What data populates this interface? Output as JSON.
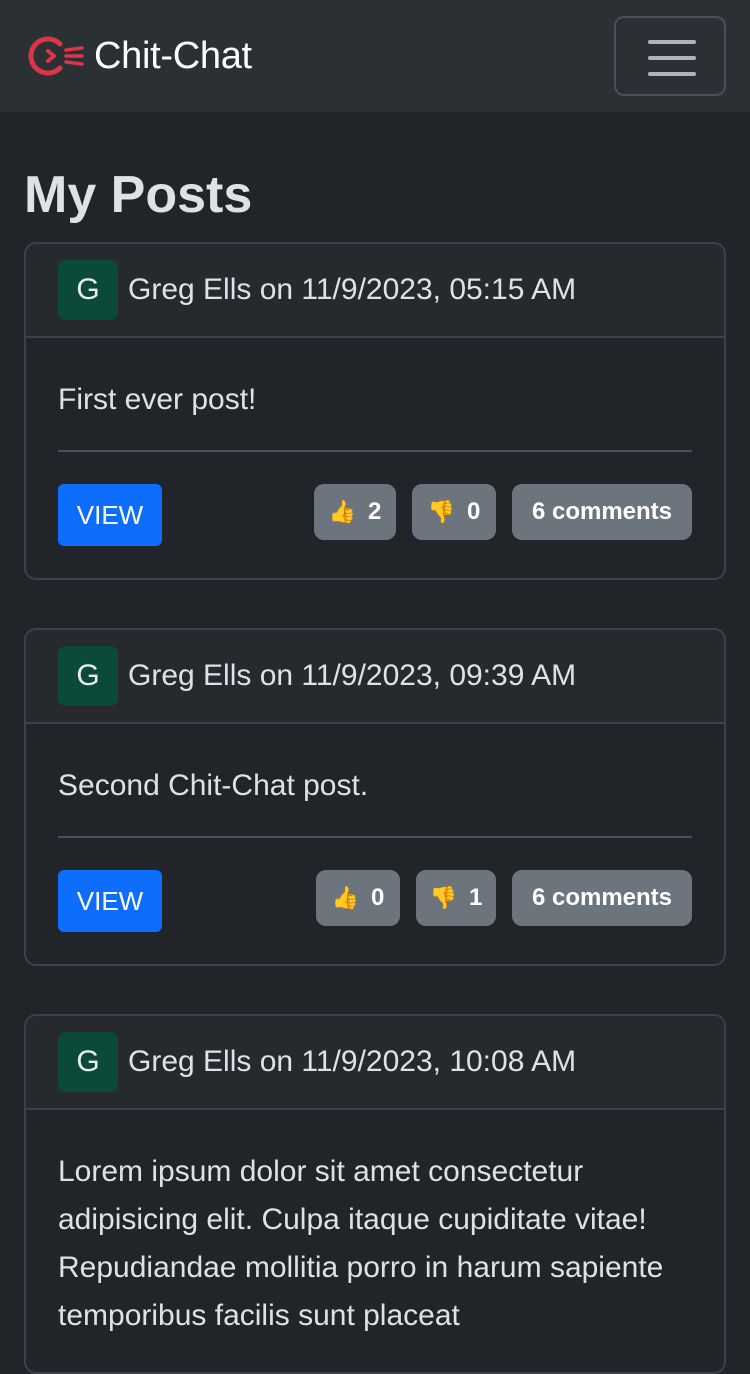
{
  "navbar": {
    "brand_name": "Chit-Chat",
    "logo_icon": "chat-mouth-icon",
    "logo_color": "#dc3545",
    "menu_icon": "hamburger-menu-icon"
  },
  "page": {
    "title": "My Posts"
  },
  "posts": [
    {
      "avatar_initial": "G",
      "author_line": "Greg Ells on 11/9/2023, 05:15 AM",
      "text": "First ever post!",
      "view_label": "VIEW",
      "likes": "2",
      "dislikes": "0",
      "comments_label": "6 comments"
    },
    {
      "avatar_initial": "G",
      "author_line": "Greg Ells on 11/9/2023, 09:39 AM",
      "text": "Second Chit-Chat post.",
      "view_label": "VIEW",
      "likes": "0",
      "dislikes": "1",
      "comments_label": "6 comments"
    },
    {
      "avatar_initial": "G",
      "author_line": "Greg Ells on 11/9/2023, 10:08 AM",
      "text": "Lorem ipsum dolor sit amet consectetur adipisicing elit. Culpa itaque cupiditate vitae! Repudiandae mollitia porro in harum sapiente temporibus facilis sunt placeat"
    }
  ],
  "icons": {
    "like": "👍",
    "dislike": "👎"
  },
  "colors": {
    "background": "#212529",
    "navbar": "#2b3035",
    "primary_button": "#0d6efd",
    "badge": "#6c757d",
    "avatar": "#0b4a3a"
  }
}
